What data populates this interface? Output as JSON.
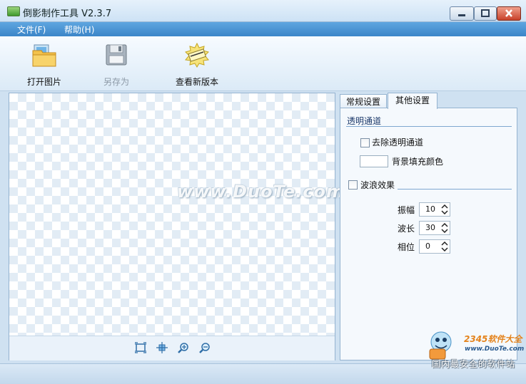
{
  "window": {
    "title": "倒影制作工具 V2.3.7"
  },
  "menu": {
    "items": [
      "文件(F)",
      "帮助(H)"
    ]
  },
  "toolbar": {
    "open_label": "打开图片",
    "save_as_label": "另存为",
    "check_update_label": "查看新版本"
  },
  "canvas": {
    "watermark": "www.DuoTe.com"
  },
  "tabs": [
    {
      "label": "常规设置",
      "active": false
    },
    {
      "label": "其他设置",
      "active": true
    }
  ],
  "other_settings": {
    "alpha_group": "透明通道",
    "remove_alpha_label": "去除透明通道",
    "remove_alpha_checked": false,
    "bg_fill_label": "背景填充颜色",
    "bg_fill_color": "#ffffff",
    "wave_label": "波浪效果",
    "wave_checked": false,
    "amplitude_label": "振幅",
    "amplitude_value": "10",
    "wavelength_label": "波长",
    "wavelength_value": "30",
    "phase_label": "相位",
    "phase_value": "0"
  },
  "branding": {
    "name": "2345软件大全",
    "url": "www.DuoTe.com",
    "tagline": "国内最安全的软件站"
  }
}
